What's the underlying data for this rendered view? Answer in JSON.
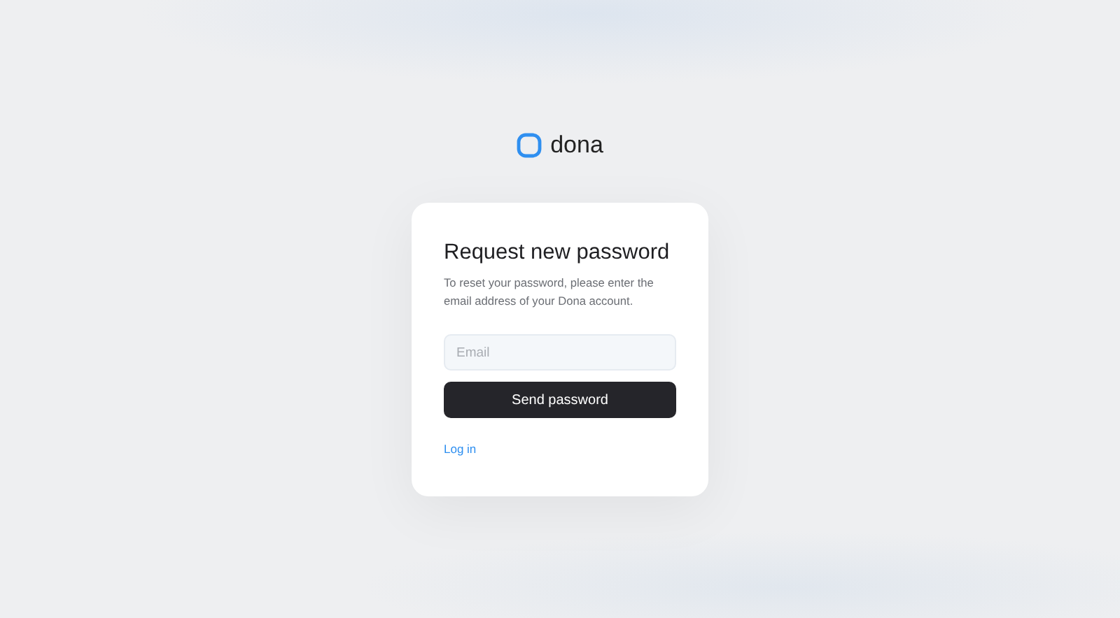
{
  "logo": {
    "name": "dona"
  },
  "card": {
    "title": "Request new password",
    "description": "To reset your password, please enter the email address of your Dona account.",
    "email_field": {
      "placeholder": "Email"
    },
    "submit_button": "Send password",
    "login_link": "Log in"
  }
}
